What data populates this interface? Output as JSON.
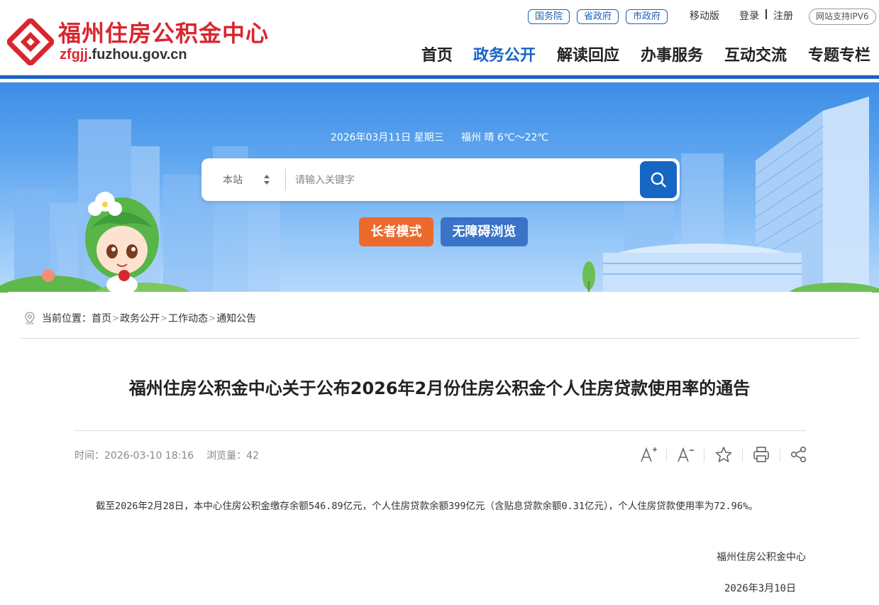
{
  "site": {
    "title": "福州住房公积金中心",
    "domain_prefix": "zfgjj",
    "domain_suffix": ".fuzhou.gov.cn",
    "brand_color": "#d8262f",
    "accent_color": "#1763c4"
  },
  "top_links": {
    "pills": [
      "国务院",
      "省政府",
      "市政府"
    ],
    "mobile": "移动版",
    "login": "登录",
    "register": "注册",
    "ipv6": "网站支持IPV6"
  },
  "nav": {
    "items": [
      "首页",
      "政务公开",
      "解读回应",
      "办事服务",
      "互动交流",
      "专题专栏"
    ],
    "active": "政务公开"
  },
  "banner": {
    "date": "2026年03月11日 星期三",
    "weather": "福州 晴 6℃～22℃"
  },
  "search": {
    "scope": "本站",
    "placeholder": "请输入关键字",
    "icon": "search-icon"
  },
  "modes": {
    "elder": "长者模式",
    "accessible": "无障碍浏览"
  },
  "breadcrumb": {
    "prefix": "当前位置：",
    "items": [
      "首页",
      "政务公开",
      "工作动态",
      "通知公告"
    ]
  },
  "article": {
    "title": "福州住房公积金中心关于公布2026年2月份住房公积金个人住房贷款使用率的通告",
    "time_label": "时间：",
    "time": "2026-03-10 18:16",
    "views_label": "浏览量：",
    "views": "42",
    "tools": [
      "font-increase-icon",
      "font-decrease-icon",
      "star-icon",
      "print-icon",
      "share-icon"
    ],
    "body": "截至2026年2月28日，本中心住房公积金缴存余额546.89亿元，个人住房贷款余额399亿元（含贴息贷款余额0.31亿元），个人住房贷款使用率为72.96%。",
    "signature": "福州住房公积金中心",
    "sign_date": "2026年3月10日"
  }
}
